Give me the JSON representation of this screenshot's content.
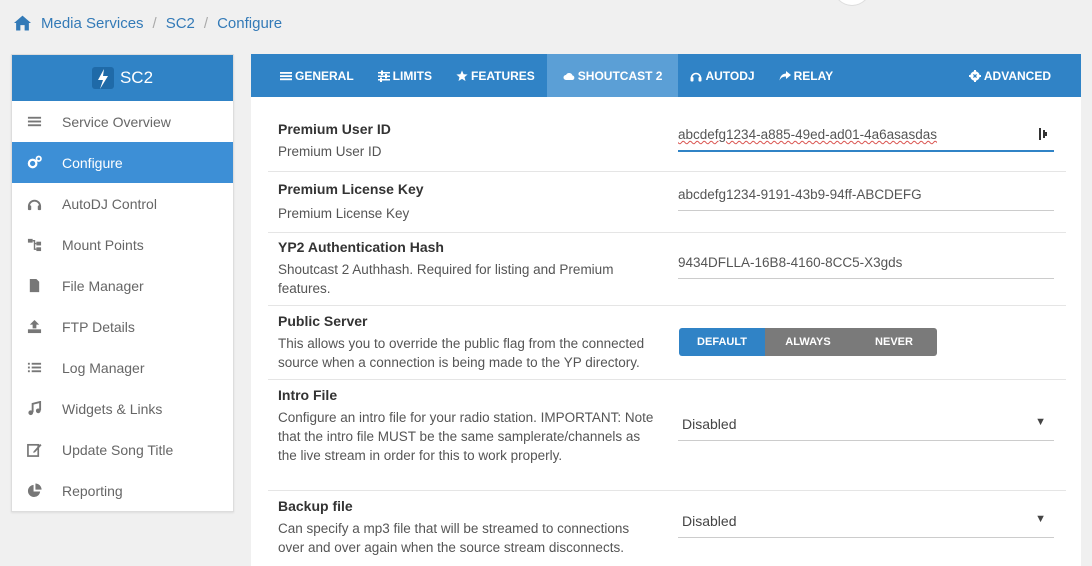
{
  "breadcrumb": [
    "Media Services",
    "SC2",
    "Configure"
  ],
  "sidebar": {
    "title": "SC2",
    "items": [
      {
        "label": "Service Overview",
        "icon": "menu-icon"
      },
      {
        "label": "Configure",
        "icon": "gears-icon",
        "active": true
      },
      {
        "label": "AutoDJ Control",
        "icon": "headphones-icon"
      },
      {
        "label": "Mount Points",
        "icon": "sitemap-icon"
      },
      {
        "label": "File Manager",
        "icon": "file-icon"
      },
      {
        "label": "FTP Details",
        "icon": "upload-icon"
      },
      {
        "label": "Log Manager",
        "icon": "list-icon"
      },
      {
        "label": "Widgets & Links",
        "icon": "music-icon"
      },
      {
        "label": "Update Song Title",
        "icon": "edit-icon"
      },
      {
        "label": "Reporting",
        "icon": "pie-chart-icon"
      }
    ]
  },
  "tabs": {
    "general": "GENERAL",
    "limits": "LIMITS",
    "features": "FEATURES",
    "shoutcast2": "SHOUTCAST 2",
    "autodj": "AUTODJ",
    "relay": "RELAY",
    "advanced": "ADVANCED"
  },
  "settings": {
    "premium_user_id": {
      "label": "Premium User ID",
      "desc": "Premium User ID",
      "value": "abcdefg1234-a885-49ed-ad01-4a6asasdas"
    },
    "premium_license_key": {
      "label": "Premium License Key",
      "desc": "Premium License Key",
      "value": "abcdefg1234-9191-43b9-94ff-ABCDEFG"
    },
    "yp2_hash": {
      "label": "YP2 Authentication Hash",
      "desc": "Shoutcast 2 Authhash. Required for listing and Premium features.",
      "value": "9434DFLLA-16B8-4160-8CC5-X3gds"
    },
    "public_server": {
      "label": "Public Server",
      "desc": "This allows you to override the public flag from the connected source when a connection is being made to the YP directory.",
      "options": [
        "DEFAULT",
        "ALWAYS",
        "NEVER"
      ],
      "selected": "DEFAULT"
    },
    "intro_file": {
      "label": "Intro File",
      "desc": "Configure an intro file for your radio station. IMPORTANT: Note that the intro file MUST be the same samplerate/channels as the live stream in order for this to work properly.",
      "value": "Disabled"
    },
    "backup_file": {
      "label": "Backup file",
      "desc": "Can specify a mp3 file that will be streamed to connections over and over again when the source stream disconnects.",
      "value": "Disabled"
    }
  },
  "colors": {
    "primary": "#3083c6",
    "active_tab": "#5b9fd6",
    "segment_off": "#7a7a7a"
  }
}
